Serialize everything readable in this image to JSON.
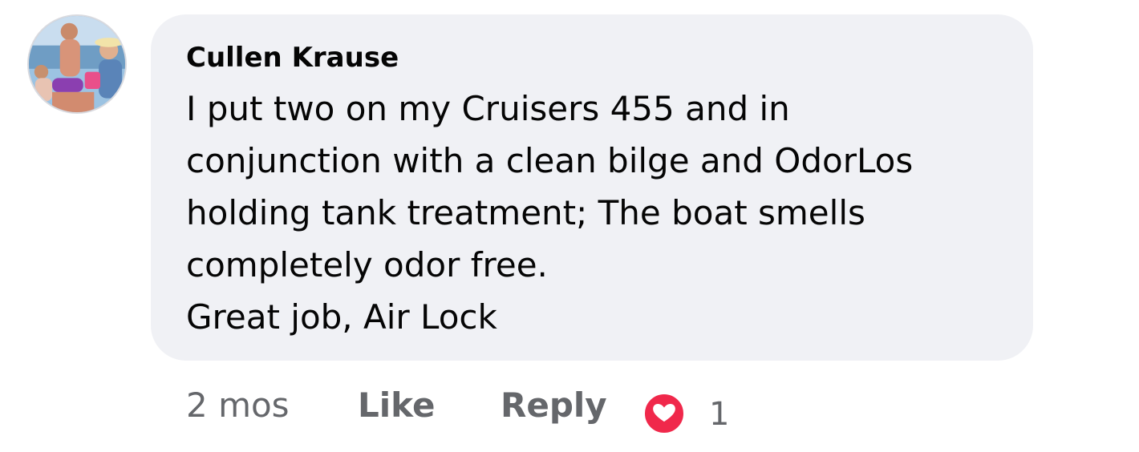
{
  "comment": {
    "author": "Cullen Krause",
    "text_lines": [
      "I put two on my Cruisers 455 and in",
      "conjunction with a clean bilge and OdorLos",
      "holding tank treatment; The boat smells",
      "completely odor free.",
      "Great job, Air Lock"
    ],
    "timestamp": "2 mos",
    "like_label": "Like",
    "reply_label": "Reply",
    "reaction_icon": "heart-icon",
    "reaction_count": "1"
  },
  "colors": {
    "bubble_bg": "#f0f1f5",
    "text": "#050505",
    "muted": "#65676b",
    "reaction": "#f0284b"
  }
}
